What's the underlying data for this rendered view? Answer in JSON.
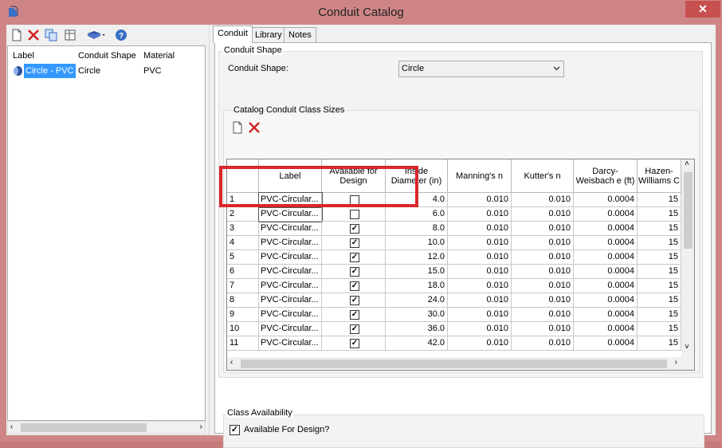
{
  "window": {
    "title": "Conduit Catalog",
    "close_label": "✕",
    "accent": "#d9262c"
  },
  "left": {
    "columns": [
      "Label",
      "Conduit Shape",
      "Material"
    ],
    "items": [
      {
        "label": "Circle - PVC",
        "shape": "Circle",
        "material": "PVC"
      }
    ]
  },
  "tabs": [
    "Conduit",
    "Library",
    "Notes"
  ],
  "conduit_shape": {
    "group_label": "Conduit Shape",
    "field_label": "Conduit Shape:",
    "value": "Circle"
  },
  "sizes": {
    "group_label": "Catalog Conduit Class Sizes",
    "columns": [
      "Label",
      "Available for Design",
      "Inside Diameter (in)",
      "Manning's n",
      "Kutter's n",
      "Darcy-Weisbach e (ft)",
      "Hazen-Williams C"
    ],
    "rows": [
      {
        "n": "1",
        "label": "PVC-Circular...",
        "avail": false,
        "dia": "4.0",
        "man": "0.010",
        "kut": "0.010",
        "dar": "0.0004",
        "haz": "15"
      },
      {
        "n": "2",
        "label": "PVC-Circular...",
        "avail": false,
        "dia": "6.0",
        "man": "0.010",
        "kut": "0.010",
        "dar": "0.0004",
        "haz": "15"
      },
      {
        "n": "3",
        "label": "PVC-Circular...",
        "avail": true,
        "dia": "8.0",
        "man": "0.010",
        "kut": "0.010",
        "dar": "0.0004",
        "haz": "15"
      },
      {
        "n": "4",
        "label": "PVC-Circular...",
        "avail": true,
        "dia": "10.0",
        "man": "0.010",
        "kut": "0.010",
        "dar": "0.0004",
        "haz": "15"
      },
      {
        "n": "5",
        "label": "PVC-Circular...",
        "avail": true,
        "dia": "12.0",
        "man": "0.010",
        "kut": "0.010",
        "dar": "0.0004",
        "haz": "15"
      },
      {
        "n": "6",
        "label": "PVC-Circular...",
        "avail": true,
        "dia": "15.0",
        "man": "0.010",
        "kut": "0.010",
        "dar": "0.0004",
        "haz": "15"
      },
      {
        "n": "7",
        "label": "PVC-Circular...",
        "avail": true,
        "dia": "18.0",
        "man": "0.010",
        "kut": "0.010",
        "dar": "0.0004",
        "haz": "15"
      },
      {
        "n": "8",
        "label": "PVC-Circular...",
        "avail": true,
        "dia": "24.0",
        "man": "0.010",
        "kut": "0.010",
        "dar": "0.0004",
        "haz": "15"
      },
      {
        "n": "9",
        "label": "PVC-Circular...",
        "avail": true,
        "dia": "30.0",
        "man": "0.010",
        "kut": "0.010",
        "dar": "0.0004",
        "haz": "15"
      },
      {
        "n": "10",
        "label": "PVC-Circular...",
        "avail": true,
        "dia": "36.0",
        "man": "0.010",
        "kut": "0.010",
        "dar": "0.0004",
        "haz": "15"
      },
      {
        "n": "11",
        "label": "PVC-Circular...",
        "avail": true,
        "dia": "42.0",
        "man": "0.010",
        "kut": "0.010",
        "dar": "0.0004",
        "haz": "15"
      }
    ]
  },
  "class_availability": {
    "group_label": "Class Availability",
    "checkbox_label": "Available For Design?",
    "checked": true
  }
}
